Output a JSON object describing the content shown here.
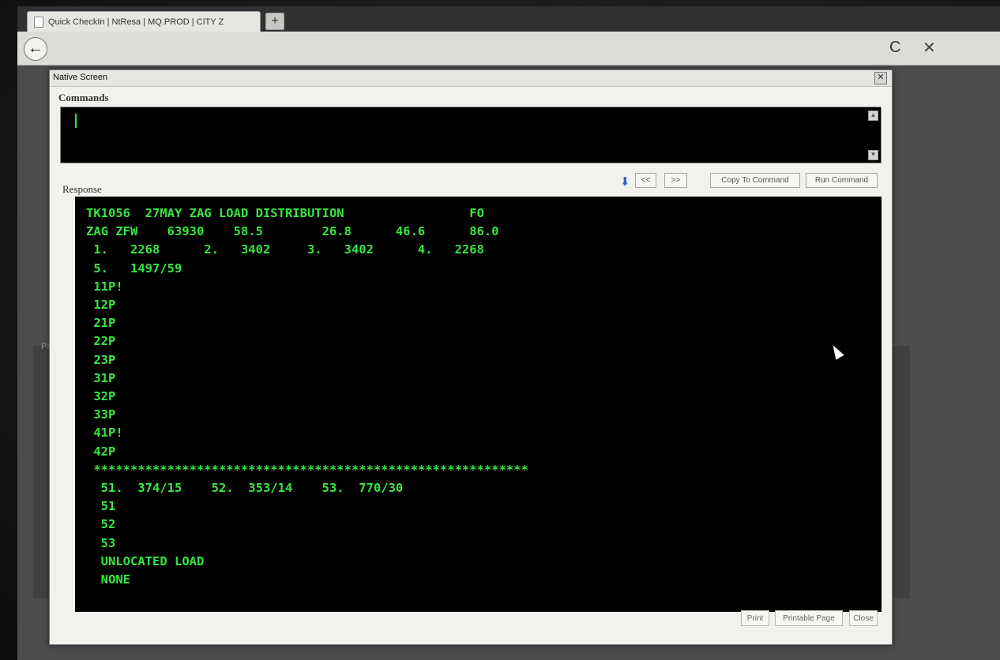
{
  "browser": {
    "tab_title": "Quick CheckIn | NtResa | MQ.PROD | CITY Z",
    "new_tab": "+",
    "back_icon": "←",
    "reload_icon": "C",
    "stop_icon": "✕"
  },
  "background_text": "Pa",
  "dialog": {
    "title": "Native Screen",
    "close_icon": "✕",
    "commands_label": "Commands",
    "response_label": "Response",
    "nav": {
      "down_icon": "⬇",
      "prev": "<<",
      "next": ">>",
      "copy_to_command": "Copy To Command",
      "run_command": "Run Command"
    },
    "response_lines": [
      "TK1056  27MAY ZAG LOAD DISTRIBUTION                 FO",
      "ZAG ZFW    63930    58.5        26.8      46.6      86.0",
      " 1.   2268      2.   3402     3.   3402      4.   2268",
      " 5.   1497/59",
      " 11P!",
      " 12P",
      " 21P",
      " 22P",
      " 23P",
      " 31P",
      " 32P",
      " 33P",
      " 41P!",
      " 42P",
      " ***********************************************************",
      "  51.  374/15    52.  353/14    53.  770/30",
      "  51",
      "  52",
      "  53",
      "  UNLOCATED LOAD",
      "  NONE"
    ],
    "footer": {
      "print": "Print",
      "printable_page": "Printable Page",
      "close": "Close"
    }
  }
}
